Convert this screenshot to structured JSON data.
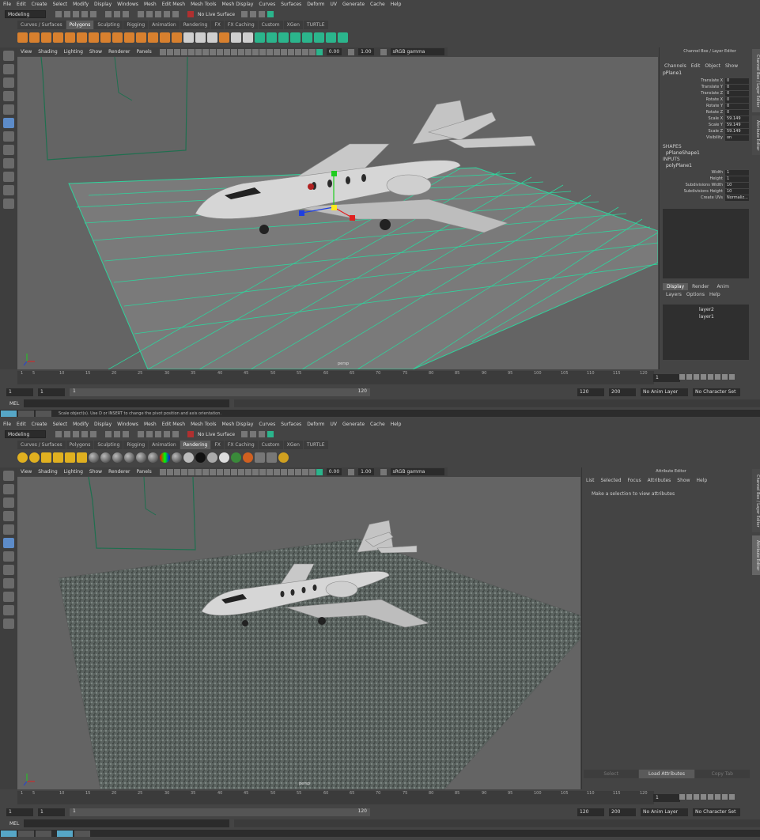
{
  "menus": [
    "File",
    "Edit",
    "Create",
    "Select",
    "Modify",
    "Display",
    "Windows",
    "Mesh",
    "Edit Mesh",
    "Mesh Tools",
    "Mesh Display",
    "Curves",
    "Surfaces",
    "Deform",
    "UV",
    "Generate",
    "Cache",
    "Help"
  ],
  "status": {
    "mode": "Modeling",
    "live": "No Live Surface"
  },
  "shelf_tabs": [
    "Curves / Surfaces",
    "Polygons",
    "Sculpting",
    "Rigging",
    "Animation",
    "Rendering",
    "FX",
    "FX Caching",
    "Custom",
    "XGen",
    "TURTLE"
  ],
  "panel_menu": [
    "View",
    "Shading",
    "Lighting",
    "Show",
    "Renderer",
    "Panels"
  ],
  "panel_values": {
    "num1": "0.00",
    "num2": "1.00",
    "colorspace": "sRGB gamma"
  },
  "viewport_label": "persp",
  "channel_box": {
    "header": "Channel Box / Layer Editor",
    "menu": [
      "Channels",
      "Edit",
      "Object",
      "Show"
    ],
    "object": "pPlane1",
    "rows": [
      {
        "k": "Translate X",
        "v": "0"
      },
      {
        "k": "Translate Y",
        "v": "0"
      },
      {
        "k": "Translate Z",
        "v": "0"
      },
      {
        "k": "Rotate X",
        "v": "0"
      },
      {
        "k": "Rotate Y",
        "v": "0"
      },
      {
        "k": "Rotate Z",
        "v": "0"
      },
      {
        "k": "Scale X",
        "v": "59.149"
      },
      {
        "k": "Scale Y",
        "v": "59.149"
      },
      {
        "k": "Scale Z",
        "v": "59.149"
      },
      {
        "k": "Visibility",
        "v": "on"
      }
    ],
    "shapes_label": "SHAPES",
    "shape_name": "pPlaneShape1",
    "inputs_label": "INPUTS",
    "input_name": "polyPlane1",
    "input_rows": [
      {
        "k": "Width",
        "v": "1"
      },
      {
        "k": "Height",
        "v": "1"
      },
      {
        "k": "Subdivisions Width",
        "v": "10"
      },
      {
        "k": "Subdivisions Height",
        "v": "10"
      },
      {
        "k": "Create UVs",
        "v": "Normaliz..."
      }
    ],
    "layer_tabs": [
      "Display",
      "Render",
      "Anim"
    ],
    "layer_menu": [
      "Layers",
      "Options",
      "Help"
    ],
    "layers": [
      "layer2",
      "layer1"
    ],
    "vtab1": "Channel Box / Layer Editor",
    "vtab2": "Attribute Editor"
  },
  "attr_editor": {
    "header": "Attribute Editor",
    "menu": [
      "List",
      "Selected",
      "Focus",
      "Attributes",
      "Show",
      "Help"
    ],
    "message": "Make a selection to view attributes",
    "buttons": [
      "Select",
      "Load Attributes",
      "Copy Tab"
    ]
  },
  "timeline": {
    "ticks": [
      "1",
      "5",
      "10",
      "15",
      "20",
      "25",
      "30",
      "35",
      "40",
      "45",
      "50",
      "55",
      "60",
      "65",
      "70",
      "75",
      "80",
      "85",
      "90",
      "95",
      "100",
      "105",
      "110",
      "115",
      "120"
    ],
    "current": "1"
  },
  "range": {
    "start": "1",
    "start2": "1",
    "slider_start": "1",
    "slider_end": "120",
    "end": "120",
    "end2": "200",
    "anim_layer": "No Anim Layer",
    "char_set": "No Character Set"
  },
  "mel": "MEL",
  "help_text": "Scale object(s). Use D or INSERT to change the pivot position and axis orientation."
}
